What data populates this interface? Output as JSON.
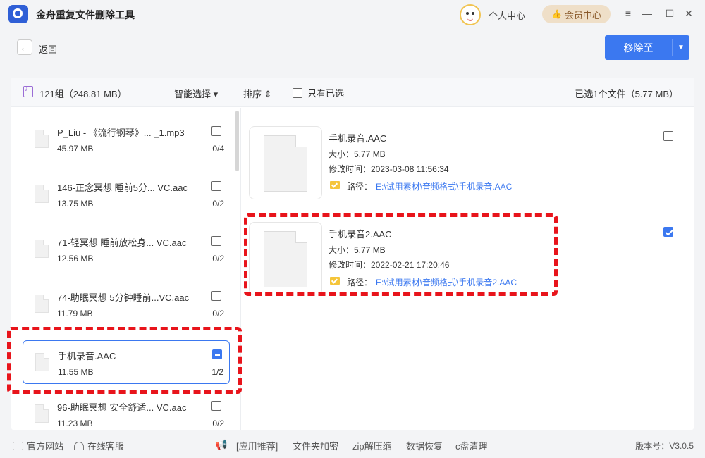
{
  "app": {
    "title": "金舟重复文件删除工具",
    "user_center": "个人中心",
    "vip_center": "会员中心"
  },
  "toolbar": {
    "back": "返回",
    "move_to": "移除至"
  },
  "header": {
    "group_count": "121组（248.81 MB）",
    "smart_select": "智能选择 ▾",
    "sort": "排序 ⇕",
    "only_selected": "只看已选",
    "selected_summary": "已选1个文件（5.77 MB）"
  },
  "groups": [
    {
      "name": "P_Liu - 《流行钢琴》...   _1.mp3",
      "size": "45.97 MB",
      "count": "0/4",
      "checked": "none"
    },
    {
      "name": "146-正念冥想 睡前5分...   VC.aac",
      "size": "13.75 MB",
      "count": "0/2",
      "checked": "none"
    },
    {
      "name": "71-轻冥想 睡前放松身...   VC.aac",
      "size": "12.56 MB",
      "count": "0/2",
      "checked": "none"
    },
    {
      "name": "74-助眠冥想 5分钟睡前...VC.aac",
      "size": "11.79 MB",
      "count": "0/2",
      "checked": "none"
    },
    {
      "name": "手机录音.AAC",
      "size": "11.55 MB",
      "count": "1/2",
      "checked": "partial"
    },
    {
      "name": "96-助眠冥想 安全舒适...   VC.aac",
      "size": "11.23 MB",
      "count": "0/2",
      "checked": "none"
    }
  ],
  "files": [
    {
      "name": "手机录音.AAC",
      "size": "大小：5.77 MB",
      "time": "修改时间：2023-03-08 11:56:34",
      "path_label": "路径：",
      "path": "E:\\试用素材\\音频格式\\手机录音.AAC",
      "checked": false
    },
    {
      "name": "手机录音2.AAC",
      "size": "大小：5.77 MB",
      "time": "修改时间：2022-02-21 17:20:46",
      "path_label": "路径：",
      "path": "E:\\试用素材\\音频格式\\手机录音2.AAC",
      "checked": true
    }
  ],
  "footer": {
    "official_site": "官方网站",
    "online_service": "在线客服",
    "recommend": "[应用推荐]",
    "folder_encrypt": "文件夹加密",
    "zip": "zip解压缩",
    "data_recovery": "数据恢复",
    "c_clean": "c盘清理",
    "version": "版本号：V3.0.5"
  },
  "colors": {
    "accent": "#3b78f0",
    "annotation": "#e8141b",
    "vip_bg": "#efdfc8"
  }
}
